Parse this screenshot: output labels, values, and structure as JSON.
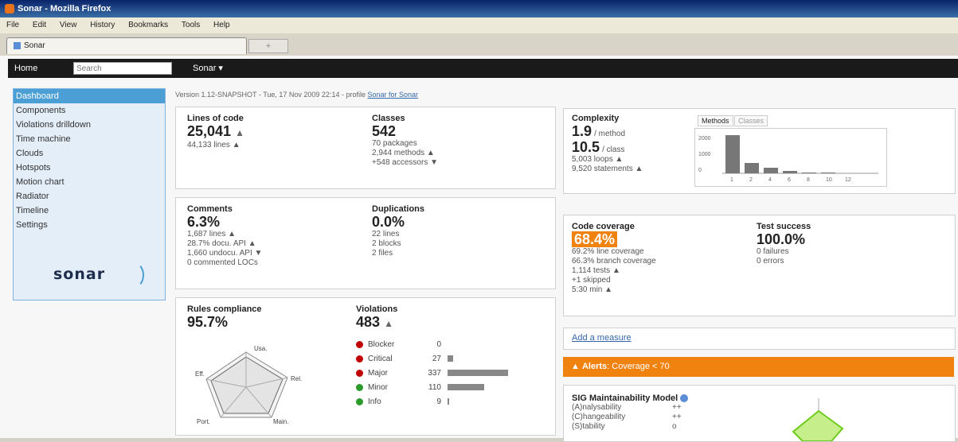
{
  "window": {
    "title": "Sonar - Mozilla Firefox"
  },
  "menu": [
    "File",
    "Edit",
    "View",
    "History",
    "Bookmarks",
    "Tools",
    "Help"
  ],
  "browser_tab": {
    "label": "Sonar",
    "newtab": "+"
  },
  "nav": {
    "home": "Home",
    "search_placeholder": "Search",
    "project": "Sonar ▾"
  },
  "sidebar": {
    "items": [
      "Dashboard",
      "Components",
      "Violations drilldown",
      "Time machine",
      "Clouds",
      "Hotspots",
      "Motion chart",
      "Radiator",
      "Timeline",
      "Settings"
    ],
    "logo": "sonar"
  },
  "version_line": {
    "text": "Version 1.12-SNAPSHOT - Tue, 17 Nov 2009 22:14 - profile",
    "profile": "Sonar for Sonar"
  },
  "loc": {
    "label": "Lines of code",
    "value": "25,041",
    "trend": "▲",
    "sub": "44,133 lines ▲"
  },
  "classes": {
    "label": "Classes",
    "value": "542",
    "lines": [
      "70 packages",
      "2,944 methods ▲",
      "+548 accessors ▼"
    ]
  },
  "complexity": {
    "label": "Complexity",
    "per_method": "1.9",
    "per_method_unit": "/ method",
    "per_class": "10.5",
    "per_class_unit": "/ class",
    "lines": [
      "5,003 loops ▲",
      "9,520 statements ▲"
    ],
    "tabs": [
      "Methods",
      "Classes"
    ]
  },
  "complexity_chart": {
    "ylabels": [
      "2000",
      "1000",
      "0"
    ],
    "xlabels": [
      "1",
      "2",
      "4",
      "6",
      "8",
      "10",
      "12"
    ],
    "values": [
      100,
      28,
      14,
      6,
      3,
      2,
      1
    ]
  },
  "comments": {
    "label": "Comments",
    "value": "6.3%",
    "lines": [
      "1,687 lines ▲",
      "28.7% docu. API ▲",
      "1,660 undocu. API ▼",
      "0 commented LOCs"
    ]
  },
  "duplications": {
    "label": "Duplications",
    "value": "0.0%",
    "lines": [
      "22 lines",
      "2 blocks",
      "2 files"
    ]
  },
  "coverage": {
    "label": "Code coverage",
    "value": "68.4%",
    "lines": [
      "69.2% line coverage",
      "66.3% branch coverage",
      "1,114 tests ▲",
      "+1 skipped",
      "5:30 min ▲"
    ]
  },
  "tests": {
    "label": "Test success",
    "value": "100.0%",
    "lines": [
      "0 failures",
      "0 errors"
    ]
  },
  "rules": {
    "label": "Rules compliance",
    "value": "95.7%",
    "radar_labels": [
      "Usa.",
      "Eff.",
      "Rel.",
      "Port.",
      "Main."
    ]
  },
  "violations": {
    "label": "Violations",
    "value": "483",
    "trend": "▲",
    "rows": [
      {
        "name": "Blocker",
        "count": "0",
        "share": 0.0,
        "color": "#c00000"
      },
      {
        "name": "Critical",
        "count": "27",
        "share": 0.09,
        "color": "#c00000"
      },
      {
        "name": "Major",
        "count": "337",
        "share": 1.0,
        "color": "#c00000"
      },
      {
        "name": "Minor",
        "count": "110",
        "share": 0.6,
        "color": "#2a9a2a"
      },
      {
        "name": "Info",
        "count": "9",
        "share": 0.03,
        "color": "#2a9a2a"
      }
    ]
  },
  "add_measure": "Add a measure",
  "alert": {
    "icon": "▲",
    "label": "Alerts",
    "text": ": Coverage < 70"
  },
  "sig": {
    "label": "SIG Maintainability Model",
    "rows": [
      {
        "name": "(A)nalysability",
        "score": "++"
      },
      {
        "name": "(C)hangeability",
        "score": "++"
      },
      {
        "name": "(S)tability",
        "score": "o"
      }
    ]
  }
}
